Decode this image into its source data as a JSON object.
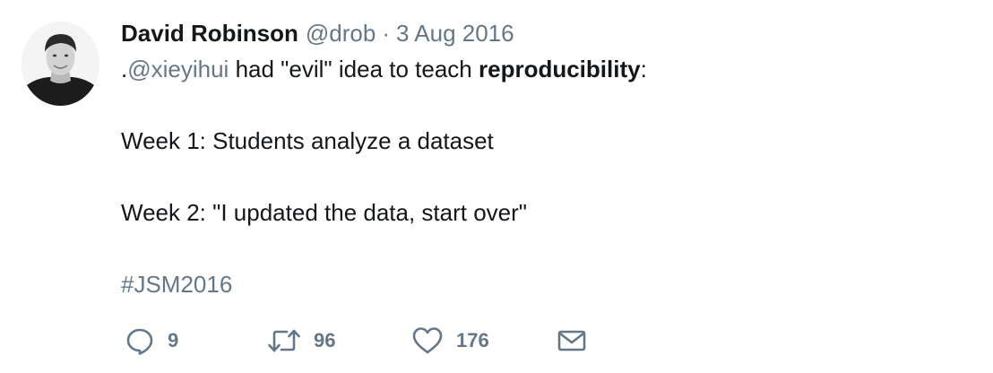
{
  "tweet": {
    "author": {
      "name": "David Robinson",
      "handle": "@drob"
    },
    "separator": "·",
    "date": "3 Aug 2016",
    "line1": {
      "prefix": ".",
      "mention": "@xieyihui",
      "middle": " had \"evil\" idea to teach ",
      "bold": "reproducibility",
      "suffix": ":"
    },
    "line2": "Week 1: Students analyze a dataset",
    "line3": "Week 2: \"I updated the data, start over\"",
    "hashtag": "#JSM2016",
    "actions": {
      "reply": {
        "icon": "reply-icon",
        "count": "9"
      },
      "retweet": {
        "icon": "retweet-icon",
        "count": "96"
      },
      "like": {
        "icon": "heart-icon",
        "count": "176"
      },
      "message": {
        "icon": "envelope-icon"
      }
    }
  },
  "colors": {
    "text": "#14171a",
    "muted": "#657786",
    "background": "#ffffff"
  }
}
